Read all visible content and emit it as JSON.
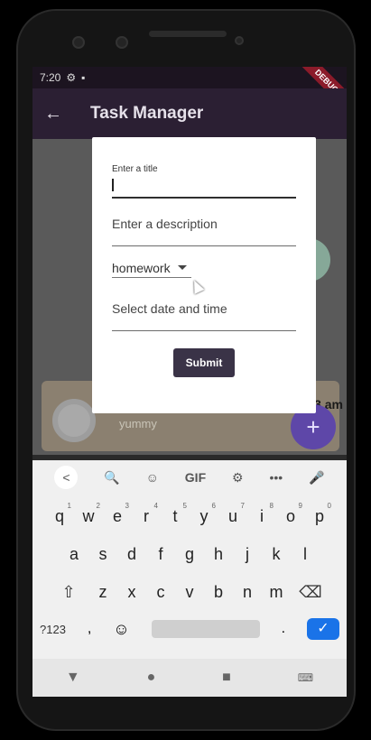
{
  "status_bar": {
    "time": "7:20",
    "debug_banner": "DEBUG"
  },
  "app_bar": {
    "title": "Task Manager"
  },
  "background_card": {
    "subtitle": "yummy",
    "time": "3 am",
    "fab_label": "+"
  },
  "dialog": {
    "title_label": "Enter a title",
    "description_placeholder": "Enter a description",
    "category_selected": "homework",
    "datetime_placeholder": "Select date and time",
    "submit_label": "Submit"
  },
  "keyboard": {
    "toolbar": [
      "<",
      "🔍",
      "☺",
      "GIF",
      "⚙",
      "•••",
      "🎤"
    ],
    "row1": [
      {
        "key": "q",
        "sup": "1"
      },
      {
        "key": "w",
        "sup": "2"
      },
      {
        "key": "e",
        "sup": "3"
      },
      {
        "key": "r",
        "sup": "4"
      },
      {
        "key": "t",
        "sup": "5"
      },
      {
        "key": "y",
        "sup": "6"
      },
      {
        "key": "u",
        "sup": "7"
      },
      {
        "key": "i",
        "sup": "8"
      },
      {
        "key": "o",
        "sup": "9"
      },
      {
        "key": "p",
        "sup": "0"
      }
    ],
    "row2": [
      "a",
      "s",
      "d",
      "f",
      "g",
      "h",
      "j",
      "k",
      "l"
    ],
    "row3": [
      "⇧",
      "z",
      "x",
      "c",
      "v",
      "b",
      "n",
      "m",
      "⌫"
    ],
    "bottom": {
      "symbols": "?123",
      "comma": ",",
      "emoji": "☺",
      "period": ".",
      "enter": "✓"
    }
  },
  "nav_bar": {
    "back": "▼",
    "home": "●",
    "recents": "■",
    "keyboard": "⌨"
  }
}
